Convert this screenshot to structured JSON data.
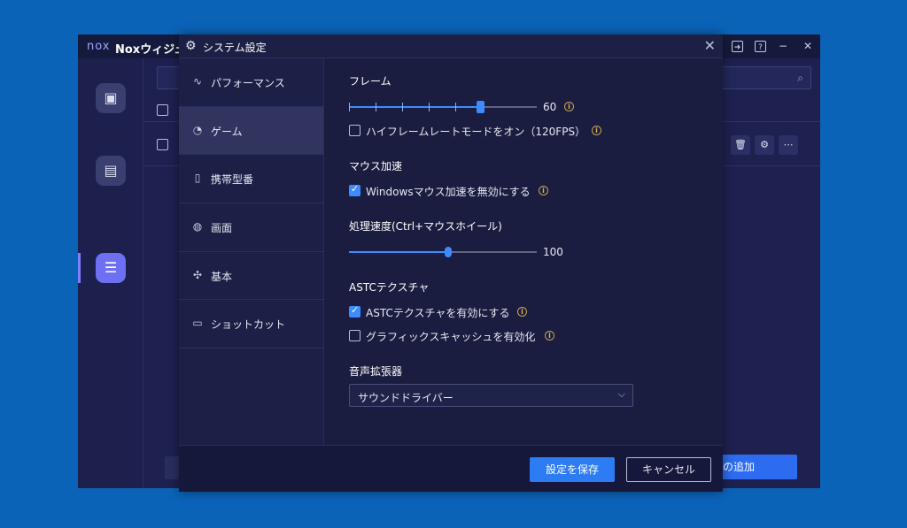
{
  "background_window": {
    "logo": "nox",
    "title": "Noxウィジュ",
    "add_button_label": "の追加",
    "title_buttons": [
      "➜",
      "?",
      "−",
      "✕"
    ]
  },
  "dialog": {
    "title": "システム設定",
    "nav": [
      {
        "label": "パフォーマンス",
        "icon": "pulse-icon"
      },
      {
        "label": "ゲーム",
        "icon": "gamepad-icon"
      },
      {
        "label": "携帯型番",
        "icon": "phone-icon"
      },
      {
        "label": "画面",
        "icon": "palette-icon"
      },
      {
        "label": "基本",
        "icon": "puzzle-icon"
      },
      {
        "label": "ショットカット",
        "icon": "keyboard-icon"
      }
    ],
    "active_nav": "ゲーム",
    "frame": {
      "heading": "フレーム",
      "value": "60",
      "slider_fraction": 0.7,
      "high_frame_label": "ハイフレームレートモードをオン（120FPS）",
      "high_frame_checked": false
    },
    "mouse": {
      "heading": "マウス加速",
      "disable_accel_label": "Windowsマウス加速を無効にする",
      "disable_accel_checked": true
    },
    "speed": {
      "heading": "処理速度(Ctrl+マウスホイール)",
      "value": "100",
      "slider_fraction": 0.53
    },
    "astc": {
      "heading": "ASTCテクスチャ",
      "enable_label": "ASTCテクスチャを有効にする",
      "enable_checked": true,
      "graphics_cache_label": "グラフィックスキャッシュを有効化",
      "graphics_cache_checked": false
    },
    "audio": {
      "heading": "音声拡張器",
      "selected": "サウンドドライバー"
    },
    "buttons": {
      "save": "設定を保存",
      "cancel": "キャンセル"
    }
  },
  "colors": {
    "accent": "#2e7cf3",
    "dialog_bg": "#1a1d3f",
    "desktop_bg": "#0b63b8"
  }
}
